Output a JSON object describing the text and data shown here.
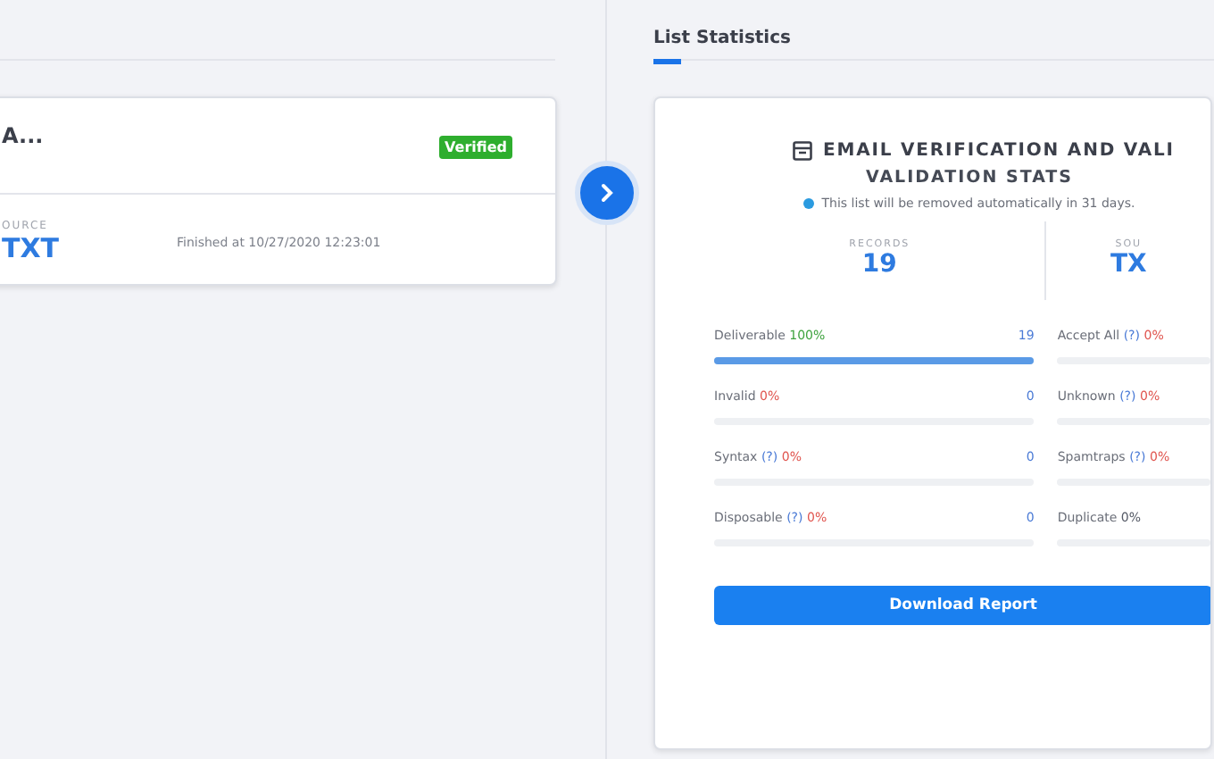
{
  "list_card": {
    "name": "A...",
    "badge": "Verified",
    "source_label": "OURCE",
    "source_value": "TXT",
    "finished": "Finished at 10/27/2020 12:23:01"
  },
  "tabs": [
    {
      "label": "List Statistics",
      "selected": true
    }
  ],
  "stats_card": {
    "title": "EMAIL VERIFICATION AND VALI",
    "subtitle": "VALIDATION STATS",
    "note": "This list will be removed automatically in 31 days.",
    "summary": [
      {
        "label": "RECORDS",
        "value": "19"
      },
      {
        "label": "SOU",
        "value": "TX"
      }
    ],
    "metrics": [
      [
        {
          "label": "Deliverable",
          "percent": "100%",
          "color": "#3fa33f",
          "count": "19",
          "level": 1
        },
        {
          "label": "Invalid",
          "percent": "0%",
          "color": "#e0554f",
          "count": "0",
          "level": 0
        },
        {
          "label": "Syntax",
          "hint": "(?)",
          "percent": "0%",
          "color": "#e0554f",
          "count": "0",
          "level": 0
        },
        {
          "label": "Disposable",
          "hint": "(?)",
          "percent": "0%",
          "color": "#e0554f",
          "count": "0",
          "level": 0
        }
      ],
      [
        {
          "label": "Accept All",
          "hint": "(?)",
          "percent": "0%",
          "color": "#e0554f",
          "level": 0
        },
        {
          "label": "Unknown",
          "hint": "(?)",
          "percent": "0%",
          "color": "#e0554f",
          "level": 0
        },
        {
          "label": "Spamtraps",
          "hint": "(?)",
          "percent": "0%",
          "color": "#e0554f",
          "level": 0
        },
        {
          "label": "Duplicate",
          "percent": "0%",
          "color": "#555a66",
          "level": 0
        }
      ]
    ],
    "button": "Download Report"
  }
}
